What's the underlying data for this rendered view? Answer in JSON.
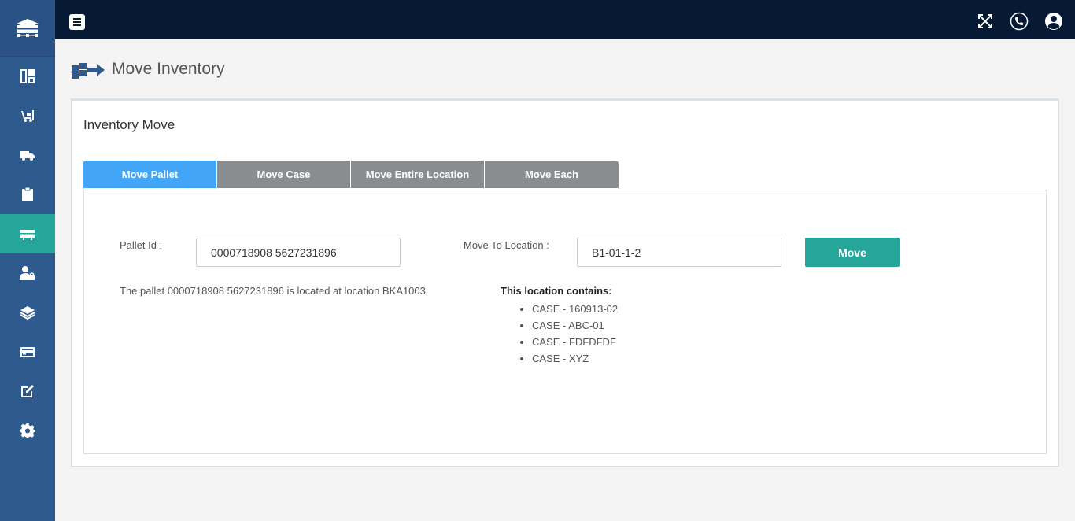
{
  "sidebar": {
    "items": [
      {
        "icon": "dashboard-icon",
        "active": false
      },
      {
        "icon": "forklift-icon",
        "active": false
      },
      {
        "icon": "truck-icon",
        "active": false
      },
      {
        "icon": "clipboard-icon",
        "active": false
      },
      {
        "icon": "inventory-move-icon",
        "active": true
      },
      {
        "icon": "user-lock-icon",
        "active": false
      },
      {
        "icon": "layers-icon",
        "active": false
      },
      {
        "icon": "card-icon",
        "active": false
      },
      {
        "icon": "edit-icon",
        "active": false
      },
      {
        "icon": "gear-icon",
        "active": false
      }
    ]
  },
  "page": {
    "title": "Move Inventory"
  },
  "panel": {
    "title": "Inventory Move"
  },
  "tabs": [
    {
      "label": "Move Pallet",
      "active": true
    },
    {
      "label": "Move Case",
      "active": false
    },
    {
      "label": "Move Entire Location",
      "active": false
    },
    {
      "label": "Move Each",
      "active": false
    }
  ],
  "form": {
    "pallet_label": "Pallet Id :",
    "pallet_value": "0000718908 5627231896",
    "location_label": "Move To Location :",
    "location_value": "B1-01-1-2",
    "move_label": "Move"
  },
  "info": {
    "pallet_message": "The pallet 0000718908 5627231896 is located at location BKA1003",
    "contains_title": "This location contains:",
    "contains_items": [
      "CASE - 160913-02",
      "CASE - ABC-01",
      "CASE - FDFDFDF",
      "CASE - XYZ"
    ]
  },
  "colors": {
    "sidebar": "#2f5a8e",
    "topbar": "#061a35",
    "accent": "#26a69a",
    "tab_active": "#42a5f5",
    "tab_inactive": "#8a8d90"
  }
}
